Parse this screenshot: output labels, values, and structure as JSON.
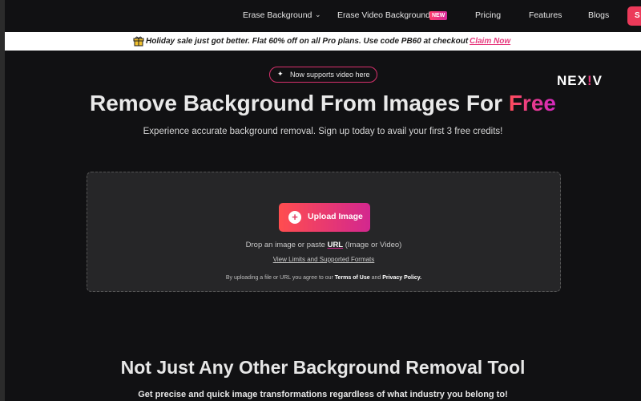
{
  "nav": {
    "items": [
      "Erase Background",
      "Erase Video Background",
      "Pricing",
      "Features",
      "Blogs"
    ],
    "new_badge": "NEW",
    "cta_label": "S"
  },
  "banner": {
    "text": "Holiday sale just got better. Flat 60% off on all Pro plans. Use code PB60 at checkout",
    "link": "Claim Now"
  },
  "hero": {
    "pill_text": "Now supports video here",
    "logo_a": "NEX",
    "logo_b": "!",
    "logo_c": "V",
    "title_main": "Remove Background From Images For ",
    "title_accent": "Free",
    "subtitle": "Experience accurate background removal. Sign up today to avail your first 3 free credits!"
  },
  "upload": {
    "button_label": "Upload Image",
    "drop_pre": "Drop an image or paste ",
    "drop_url": "URL",
    "drop_post": " (Image or Video)",
    "limits_link": "View Limits and Supported Formats",
    "terms_pre": "By uploading a file or URL you agree to our ",
    "terms_link": "Terms of Use",
    "terms_mid": " and ",
    "privacy_link": "Privacy Policy."
  },
  "section2": {
    "title": "Not Just Any Other Background Removal Tool",
    "subtitle": "Get precise and quick image transformations regardless of what industry you belong to!"
  },
  "colors": {
    "accent_pink": "#e6397d",
    "gradient_start": "#ff4d4f",
    "gradient_end": "#d3278f",
    "background": "#111113"
  }
}
